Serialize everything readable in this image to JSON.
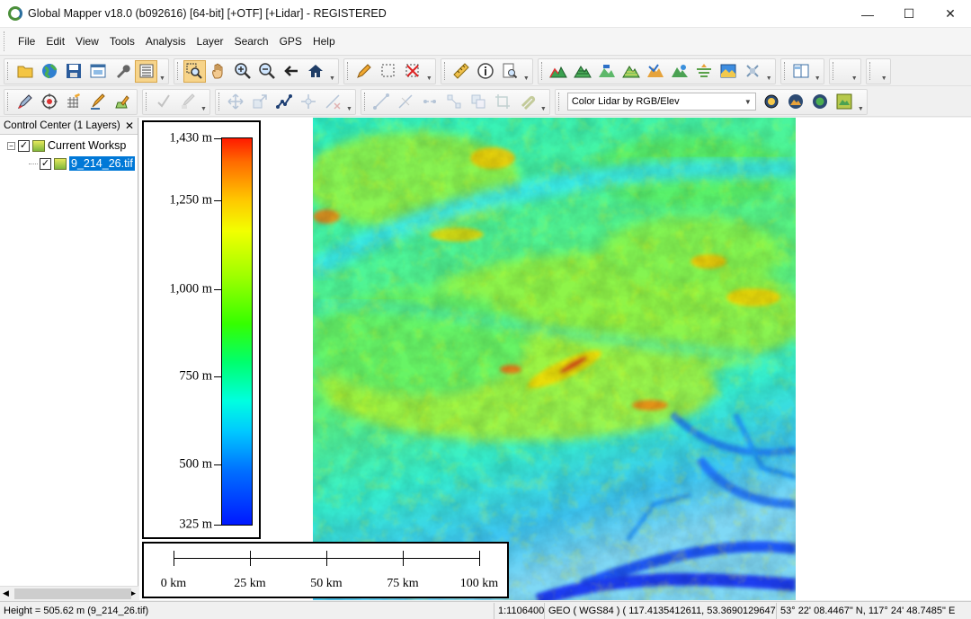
{
  "window": {
    "title": "Global Mapper v18.0 (b092616) [64-bit] [+OTF] [+Lidar] - REGISTERED",
    "minimize": "—",
    "maximize": "☐",
    "close": "✕"
  },
  "menu": [
    "File",
    "Edit",
    "View",
    "Tools",
    "Analysis",
    "Layer",
    "Search",
    "GPS",
    "Help"
  ],
  "toolbar": {
    "shader_select": "Color Lidar by RGB/Elev"
  },
  "control_center": {
    "title": "Control Center (1 Layers)",
    "close": "✕",
    "workspace_label": "Current Worksp",
    "layer_name": "9_214_26.tif",
    "workspace_checked": "✓",
    "layer_checked": "✓"
  },
  "legend": {
    "labels": [
      "1,430 m",
      "1,250 m",
      "1,000 m",
      "750 m",
      "500 m",
      "325 m"
    ]
  },
  "scalebar": {
    "labels": [
      "0 km",
      "25 km",
      "50 km",
      "75 km",
      "100 km"
    ]
  },
  "status": {
    "height": "Height = 505.62 m (9_214_26.tif)",
    "scale": "1:1106400",
    "projection": "GEO ( WGS84 ) ( 117.4135412611, 53.3690129647 )",
    "coords": "53° 22' 08.4467\" N, 117° 24' 48.7485\" E"
  },
  "colors": {
    "selection": "#0078d7",
    "active_tool": "#f7d48a",
    "elev_high": "#ff1a00",
    "elev_low": "#0018ff"
  }
}
